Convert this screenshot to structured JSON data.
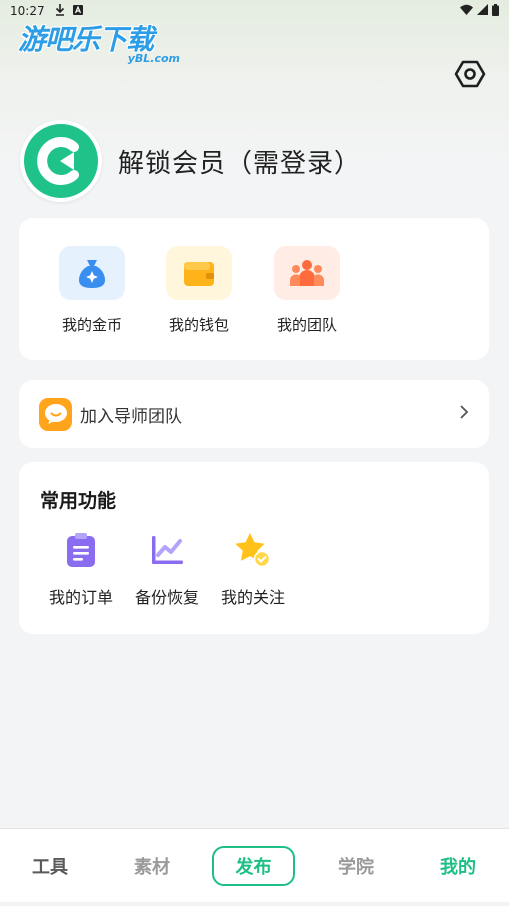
{
  "status_bar": {
    "time": "10:27",
    "icons": [
      "download-icon",
      "a-icon",
      "wifi-icon",
      "signal-icon",
      "battery-icon"
    ]
  },
  "watermark": {
    "title": "游吧乐下载",
    "site": "yBL.com"
  },
  "profile": {
    "name": "解锁会员（需登录）"
  },
  "wallet": {
    "items": [
      {
        "label": "我的金币",
        "icon": "coin-bag-icon",
        "color": "#3a8ef0"
      },
      {
        "label": "我的钱包",
        "icon": "wallet-icon",
        "color": "#ffb31a"
      },
      {
        "label": "我的团队",
        "icon": "team-icon",
        "color": "#ff6b3d"
      }
    ]
  },
  "mentor": {
    "label": "加入导师团队"
  },
  "functions": {
    "title": "常用功能",
    "items": [
      {
        "label": "我的订单",
        "icon": "order-clipboard-icon"
      },
      {
        "label": "备份恢复",
        "icon": "backup-chart-icon"
      },
      {
        "label": "我的关注",
        "icon": "star-check-icon"
      }
    ]
  },
  "tabs": [
    {
      "label": "工具"
    },
    {
      "label": "素材"
    },
    {
      "label": "发布"
    },
    {
      "label": "学院"
    },
    {
      "label": "我的"
    }
  ],
  "colors": {
    "accent": "#1dbf85",
    "background": "#f3f4f5"
  }
}
